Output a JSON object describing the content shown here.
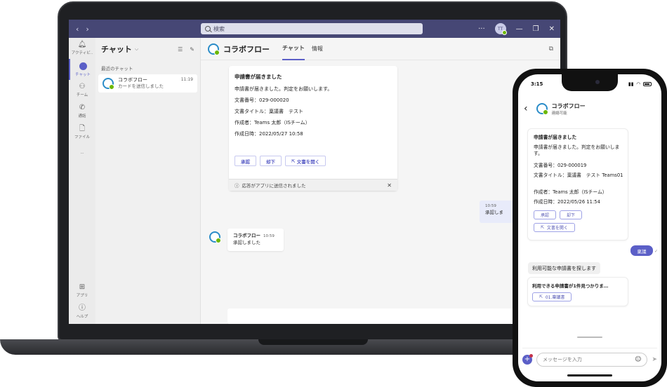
{
  "desktop": {
    "search_placeholder": "検索",
    "title_more": "···",
    "user_initials": "TT",
    "rail": {
      "activity": "アクティビ..",
      "chat": "チャット",
      "teams": "チーム",
      "calls": "通話",
      "files": "ファイル",
      "more": "···",
      "apps": "アプリ",
      "help": "ヘルプ"
    },
    "chatlist": {
      "title": "チャット",
      "section": "最近のチャット",
      "item": {
        "name": "コラボフロー",
        "preview": "カードを送信しました",
        "time": "11:19"
      }
    },
    "main": {
      "bot_name": "コラボフロー",
      "tab_chat": "チャット",
      "tab_info": "情報",
      "card": {
        "title": "申請書が届きました",
        "message": "申請書が届きました。判定をお願いします。",
        "doc_number": "文書番号：029-000020",
        "doc_title": "文書タイトル：稟議書　テスト",
        "author": "作成者：Teams 太郎（ISチーム）",
        "created": "作成日時：2022/05/27 10:58",
        "btn_approve": "承認",
        "btn_reject": "却下",
        "btn_open": "文書を開く",
        "footer": "応答がアプリに送信されました"
      },
      "own_message": {
        "time": "10:59",
        "text": "承認しま"
      },
      "bot_message": {
        "sender": "コラボフロー",
        "time": "10:59",
        "text": "承認しました"
      }
    }
  },
  "mobile": {
    "status_time": "3:15",
    "bot_name": "コラボフロー",
    "bot_status": "連絡可能",
    "card": {
      "title": "申請書が届きました",
      "message": "申請書が届きました。判定をお願いします。",
      "doc_number": "文書番号：029-000019",
      "doc_title": "文書タイトル：稟議書　テスト Teams01",
      "author": "作成者：Teams 太郎（ISチーム）",
      "created": "作成日時：2022/05/26 11:54",
      "btn_approve": "承認",
      "btn_reject": "却下",
      "btn_open": "文書を開く"
    },
    "own_message": "稟議",
    "search_text": "利用可能な申請書を探します",
    "result_title": "利用できる申請書が1件見つかりま…",
    "result_button": "01.稟議書",
    "compose_placeholder": "メッセージを入力"
  }
}
